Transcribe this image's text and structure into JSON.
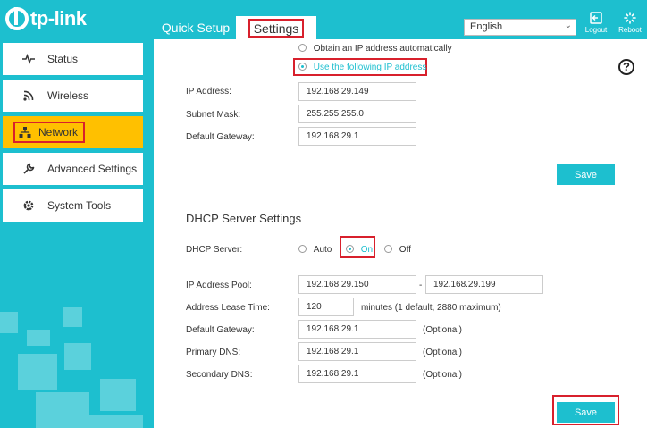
{
  "header": {
    "brand": "tp-link",
    "tabs": [
      {
        "label": "Quick Setup"
      },
      {
        "label": "Settings"
      }
    ],
    "language": "English",
    "logout_label": "Logout",
    "reboot_label": "Reboot"
  },
  "sidebar": {
    "items": [
      {
        "label": "Status",
        "icon": "pulse-icon"
      },
      {
        "label": "Wireless",
        "icon": "wifi-icon"
      },
      {
        "label": "Network",
        "icon": "network-icon",
        "active": true
      },
      {
        "label": "Advanced Settings",
        "icon": "wrench-icon"
      },
      {
        "label": "System Tools",
        "icon": "gear-icon"
      }
    ]
  },
  "wan": {
    "option_auto": "Obtain an IP address automatically",
    "option_static": "Use the following IP address",
    "selected": "static",
    "ip_label": "IP Address:",
    "ip_value": "192.168.29.149",
    "mask_label": "Subnet Mask:",
    "mask_value": "255.255.255.0",
    "gateway_label": "Default Gateway:",
    "gateway_value": "192.168.29.1",
    "save_label": "Save"
  },
  "dhcp": {
    "title": "DHCP Server Settings",
    "server_label": "DHCP Server:",
    "options": [
      "Auto",
      "On",
      "Off"
    ],
    "selected": "On",
    "pool_label": "IP Address Pool:",
    "pool_start": "192.168.29.150",
    "pool_sep": "-",
    "pool_end": "192.168.29.199",
    "lease_label": "Address Lease Time:",
    "lease_value": "120",
    "lease_hint": "minutes (1 default, 2880 maximum)",
    "gateway_label": "Default Gateway:",
    "gateway_value": "192.168.29.1",
    "primary_dns_label": "Primary DNS:",
    "primary_dns_value": "192.168.29.1",
    "secondary_dns_label": "Secondary DNS:",
    "secondary_dns_value": "192.168.29.1",
    "optional_label": "(Optional)",
    "save_label": "Save"
  },
  "colors": {
    "accent": "#1dbfcf",
    "active_nav": "#ffc000",
    "highlight": "#d8202c"
  }
}
